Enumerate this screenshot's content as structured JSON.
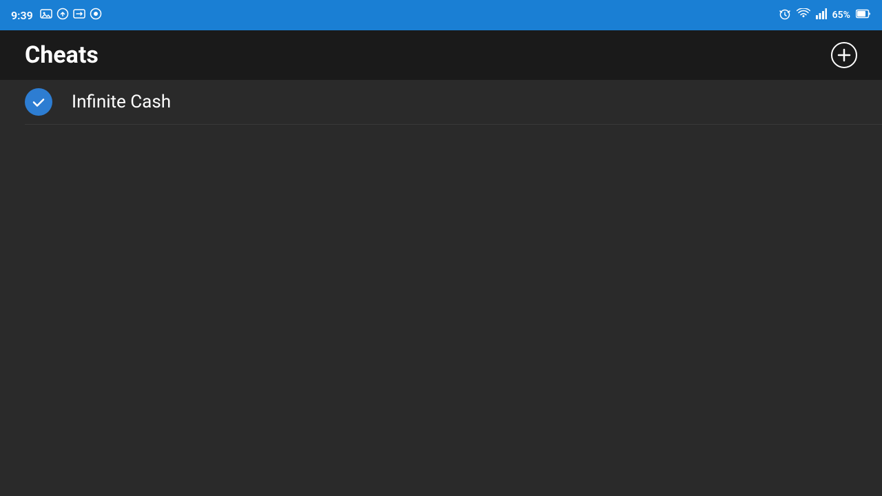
{
  "status_bar": {
    "time": "9:39",
    "battery_text": "65%",
    "icons": {
      "alarm": "⏰",
      "wifi": "wifi",
      "signal": "signal",
      "battery": "battery"
    }
  },
  "header": {
    "title": "Cheats",
    "add_button_label": "+"
  },
  "cheats": [
    {
      "name": "Infinite Cash",
      "enabled": true
    }
  ]
}
